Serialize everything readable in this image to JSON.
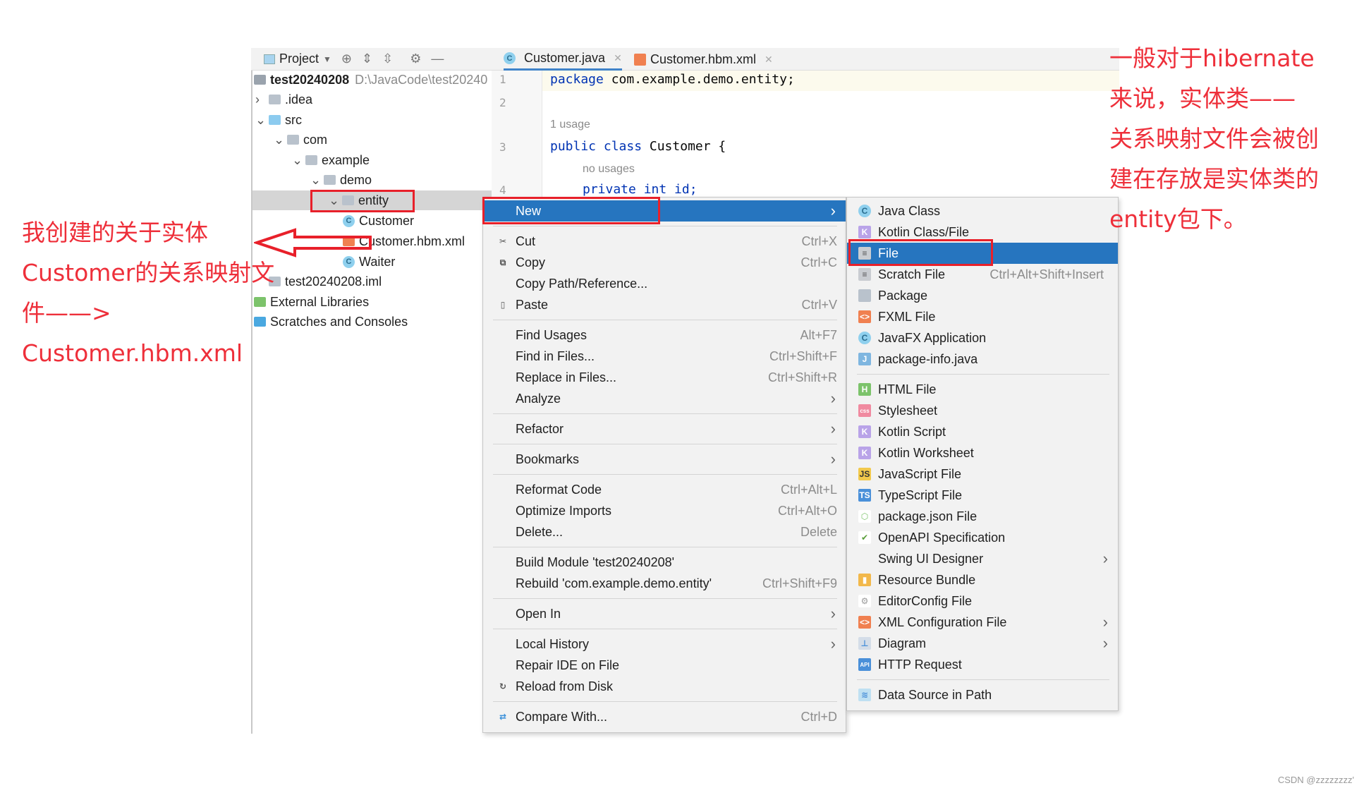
{
  "project_toolbar": {
    "label": "Project"
  },
  "tabs": [
    {
      "label": "Customer.java",
      "icon": "java-class-icon",
      "active": true
    },
    {
      "label": "Customer.hbm.xml",
      "icon": "xml-file-icon",
      "active": false
    }
  ],
  "tree": [
    {
      "label": "test20240208",
      "hint": "D:\\JavaCode\\test20240",
      "icon": "module",
      "level": 0,
      "bold": true
    },
    {
      "label": ".idea",
      "icon": "folder",
      "level": 1,
      "chevron": "›"
    },
    {
      "label": "src",
      "icon": "src-folder",
      "level": 1,
      "chevron": "⌄"
    },
    {
      "label": "com",
      "icon": "package",
      "level": 2,
      "chevron": "⌄"
    },
    {
      "label": "example",
      "icon": "package",
      "level": 3,
      "chevron": "⌄"
    },
    {
      "label": "demo",
      "icon": "package",
      "level": 4,
      "chevron": "⌄"
    },
    {
      "label": "entity",
      "icon": "package",
      "level": 5,
      "chevron": "⌄",
      "selected": true
    },
    {
      "label": "Customer",
      "icon": "class",
      "level": 6
    },
    {
      "label": "Customer.hbm.xml",
      "icon": "xml",
      "level": 6
    },
    {
      "label": "Waiter",
      "icon": "class",
      "level": 6
    },
    {
      "label": "test20240208.iml",
      "icon": "iml",
      "level": 1
    },
    {
      "label": "External Libraries",
      "icon": "libraries",
      "level": 0
    },
    {
      "label": "Scratches and Consoles",
      "icon": "scratches",
      "level": 0
    }
  ],
  "editor": {
    "line_numbers": [
      "1",
      "2",
      "3",
      "4"
    ],
    "line1_kw": "package",
    "line1_rest": " com.example.demo.entity;",
    "usage_hint": "1 usage",
    "line3_kw": "public class",
    "line3_rest": " Customer {",
    "no_usages_hint": "no usages",
    "line4_partial": "private int id;"
  },
  "context_menu": [
    {
      "label": "New",
      "submenu": true,
      "highlighted": true
    },
    {
      "sep": true
    },
    {
      "label": "Cut",
      "shortcut": "Ctrl+X",
      "icon": "scissors"
    },
    {
      "label": "Copy",
      "shortcut": "Ctrl+C",
      "icon": "copy"
    },
    {
      "label": "Copy Path/Reference..."
    },
    {
      "label": "Paste",
      "shortcut": "Ctrl+V",
      "icon": "clipboard"
    },
    {
      "sep": true
    },
    {
      "label": "Find Usages",
      "shortcut": "Alt+F7"
    },
    {
      "label": "Find in Files...",
      "shortcut": "Ctrl+Shift+F"
    },
    {
      "label": "Replace in Files...",
      "shortcut": "Ctrl+Shift+R"
    },
    {
      "label": "Analyze",
      "submenu": true
    },
    {
      "sep": true
    },
    {
      "label": "Refactor",
      "submenu": true
    },
    {
      "sep": true
    },
    {
      "label": "Bookmarks",
      "submenu": true
    },
    {
      "sep": true
    },
    {
      "label": "Reformat Code",
      "shortcut": "Ctrl+Alt+L"
    },
    {
      "label": "Optimize Imports",
      "shortcut": "Ctrl+Alt+O"
    },
    {
      "label": "Delete...",
      "shortcut": "Delete"
    },
    {
      "sep": true
    },
    {
      "label": "Build Module 'test20240208'"
    },
    {
      "label": "Rebuild 'com.example.demo.entity'",
      "shortcut": "Ctrl+Shift+F9"
    },
    {
      "sep": true
    },
    {
      "label": "Open In",
      "submenu": true
    },
    {
      "sep": true
    },
    {
      "label": "Local History",
      "submenu": true
    },
    {
      "label": "Repair IDE on File"
    },
    {
      "label": "Reload from Disk",
      "icon": "reload"
    },
    {
      "sep": true
    },
    {
      "label": "Compare With...",
      "shortcut": "Ctrl+D",
      "icon": "compare"
    }
  ],
  "new_submenu": [
    {
      "label": "Java Class",
      "icon": "class"
    },
    {
      "label": "Kotlin Class/File",
      "icon": "kotlin"
    },
    {
      "label": "File",
      "icon": "file",
      "highlighted": true
    },
    {
      "label": "Scratch File",
      "shortcut": "Ctrl+Alt+Shift+Insert",
      "icon": "scratch"
    },
    {
      "label": "Package",
      "icon": "folder"
    },
    {
      "label": "FXML File",
      "icon": "xml"
    },
    {
      "label": "JavaFX Application",
      "icon": "class"
    },
    {
      "label": "package-info.java",
      "icon": "java-file"
    },
    {
      "sep": true
    },
    {
      "label": "HTML File",
      "icon": "html"
    },
    {
      "label": "Stylesheet",
      "icon": "css"
    },
    {
      "label": "Kotlin Script",
      "icon": "kotlin"
    },
    {
      "label": "Kotlin Worksheet",
      "icon": "kotlin"
    },
    {
      "label": "JavaScript File",
      "icon": "js"
    },
    {
      "label": "TypeScript File",
      "icon": "ts"
    },
    {
      "label": "package.json File",
      "icon": "nodejs"
    },
    {
      "label": "OpenAPI Specification",
      "icon": "openapi"
    },
    {
      "label": "Swing UI Designer",
      "submenu": true
    },
    {
      "label": "Resource Bundle",
      "icon": "bundle"
    },
    {
      "label": "EditorConfig File",
      "icon": "gear"
    },
    {
      "label": "XML Configuration File",
      "icon": "xml",
      "submenu": true
    },
    {
      "label": "Diagram",
      "icon": "diagram",
      "submenu": true
    },
    {
      "label": "HTTP Request",
      "icon": "api"
    },
    {
      "sep": true
    },
    {
      "label": "Data Source in Path",
      "icon": "database"
    }
  ],
  "annotations": {
    "left": [
      "我创建的关于实体",
      "Customer的关系映射文",
      "件——>",
      "Customer.hbm.xml"
    ],
    "right": [
      "一般对于hibernate",
      "来说，实体类——",
      "关系映射文件会被创",
      "建在存放是实体类的",
      "entity包下。"
    ]
  },
  "watermark": "CSDN @zzzzzzzz'",
  "colors": {
    "accent": "#2675bf",
    "annotation": "#ee2f3a",
    "menu_bg": "#f2f2f2"
  }
}
